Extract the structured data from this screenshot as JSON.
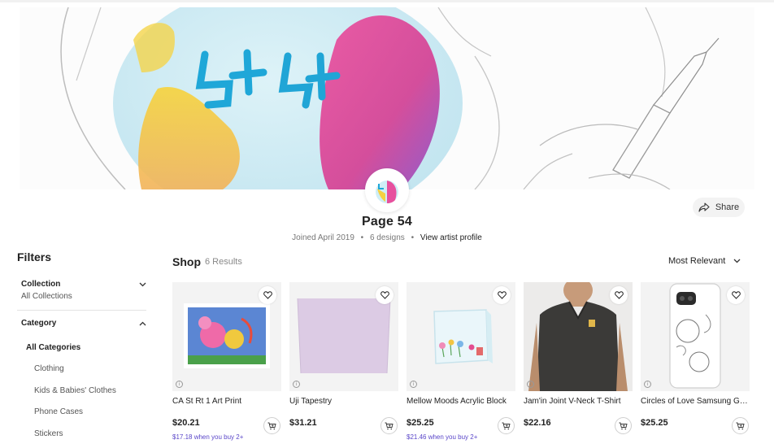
{
  "artist": {
    "name": "Page 54",
    "joined": "Joined April 2019",
    "designs": "6 designs",
    "profile_link": "View artist profile",
    "banner_text": "54"
  },
  "share": {
    "label": "Share",
    "icon": "share-arrow-icon"
  },
  "filters": {
    "title": "Filters",
    "collection": {
      "label": "Collection",
      "value": "All Collections",
      "icon": "chevron-down-icon"
    },
    "category": {
      "label": "Category",
      "icon": "chevron-up-icon",
      "items": [
        "All Categories",
        "Clothing",
        "Kids & Babies' Clothes",
        "Phone Cases",
        "Stickers"
      ]
    }
  },
  "shop": {
    "title": "Shop",
    "count": "6 Results",
    "sort": "Most Relevant"
  },
  "products": [
    {
      "title": "CA St Rt 1 Art Print",
      "price": "$20.21",
      "promo": "$17.18 when you buy 2+"
    },
    {
      "title": "Uji Tapestry",
      "price": "$31.21",
      "promo": ""
    },
    {
      "title": "Mellow Moods Acrylic Block",
      "price": "$25.25",
      "promo": "$21.46 when you buy 2+"
    },
    {
      "title": "Jam'in Joint V-Neck T-Shirt",
      "price": "$22.16",
      "promo": ""
    },
    {
      "title": "Circles of Love Samsung Galaxy Phone Case",
      "price": "$25.25",
      "promo": ""
    }
  ],
  "colors": {
    "promo": "#5a46c9",
    "tile_bg": "#f3f3f3",
    "tapestry": "#dccbe4",
    "tshirt": "#3b3a38"
  }
}
